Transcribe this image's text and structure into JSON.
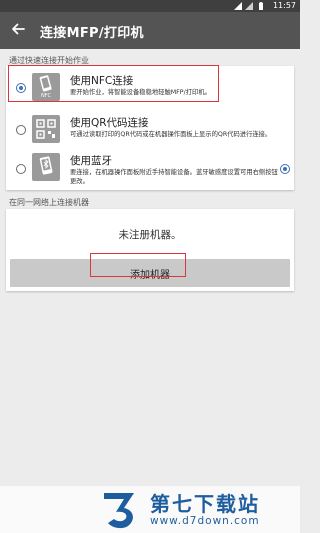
{
  "status_bar": {
    "time": "11:57"
  },
  "app_bar": {
    "title": "连接MFP/打印机",
    "back_icon": "arrow-back-icon"
  },
  "quick_connect": {
    "section_label": "通过快速连接开始作业",
    "options": [
      {
        "title": "使用NFC连接",
        "description": "要开始作业，将智能设备稳稳地轻触MFP/打印机。",
        "thumb_label": "NFC",
        "selected": true,
        "icon": "nfc-phone-icon"
      },
      {
        "title": "使用QR代码连接",
        "description": "可通过读取打印的QR代码或在机器操作面板上显示的QR代码进行连接。",
        "selected": false,
        "icon": "qr-code-icon"
      },
      {
        "title": "使用蓝牙",
        "description": "要连接，在机器操作面板附近手持智能设备。蓝牙敏感度设置可用右侧按钮更改。",
        "selected": false,
        "icon": "bluetooth-phone-icon",
        "side_radio_selected": true
      }
    ]
  },
  "same_network": {
    "section_label": "在同一网络上连接机器",
    "empty_text": "未注册机器。",
    "add_button_label": "添加机器"
  },
  "watermark": {
    "title": "第七下载站",
    "url": "www.d7down.com"
  },
  "colors": {
    "app_bar": "#545454",
    "status_bar": "#3f3f3f",
    "accent": "#3f6fb3",
    "highlight": "#d9363e",
    "brand": "#1f5e9e"
  }
}
